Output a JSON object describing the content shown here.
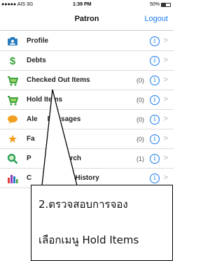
{
  "status": {
    "carrier": "●●●●● AIS  3G",
    "time": "1:39 PM",
    "battery": "50%"
  },
  "nav": {
    "title": "Patron",
    "logout": "Logout"
  },
  "rows": [
    {
      "label": "Profile",
      "count": "",
      "icon": "profile-card-icon",
      "color": "#2b7bbf"
    },
    {
      "label": "Debts",
      "count": "",
      "icon": "dollar-icon",
      "color": "#3aa33a"
    },
    {
      "label": "Checked Out Items",
      "count": "(0)",
      "icon": "cart-out-icon",
      "color": "#3aa33a"
    },
    {
      "label": "Hold Items",
      "count": "(0)",
      "icon": "cart-hold-icon",
      "color": "#3aa33a"
    },
    {
      "label": "Alert Messages",
      "count": "(0)",
      "icon": "speech-bubble-icon",
      "color": "#f0a020"
    },
    {
      "label": "Favorite",
      "count": "(0)",
      "icon": "star-icon",
      "color": "#f29a1a"
    },
    {
      "label": "Personal Search",
      "count": "(1)",
      "icon": "search-icon",
      "color": "#2fa05a"
    },
    {
      "label": "Checkout History",
      "count": "",
      "icon": "bar-chart-icon",
      "color": "#8a3ab9"
    }
  ],
  "visible_labels": {
    "alert_messages": "Ale",
    "alert_messages_tail": "Messages",
    "favorite": "Fa",
    "personal_search": "P",
    "personal_search_tail": "Search",
    "checkout_history": "C",
    "checkout_history_tail": "t History"
  },
  "callout": {
    "line1": "2.ตรวจสอบการจอง",
    "line2": "เลือกเมนู Hold Items"
  }
}
